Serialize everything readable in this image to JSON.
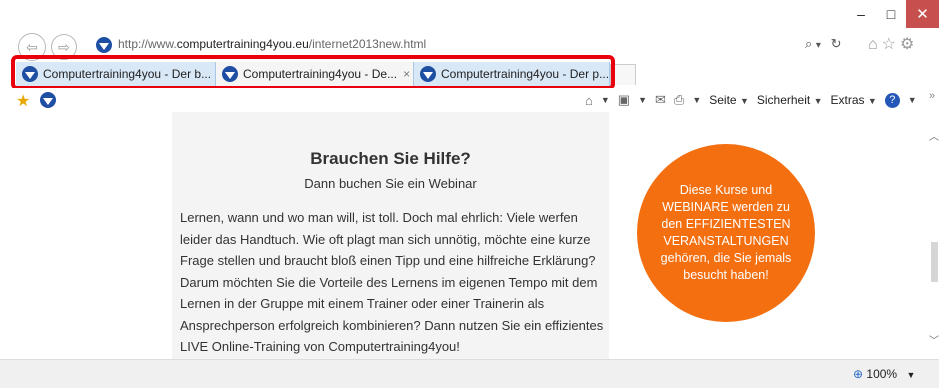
{
  "window": {
    "minimize": "–",
    "maximize": "□",
    "close": "✕"
  },
  "address": {
    "url_prefix": "http://www.",
    "url_domain": "computertraining4you.eu",
    "url_path": "/internet2013new.html",
    "search_icon": "⌕",
    "dropdown": "▾",
    "refresh": "↻"
  },
  "nav": {
    "back": "⇦",
    "forward": "⇨"
  },
  "right_icons": [
    "home-icon",
    "star-icon",
    "gear-icon"
  ],
  "tabs": [
    {
      "label": "Computertraining4you - Der b..."
    },
    {
      "label": "Computertraining4you - De...",
      "close": "×"
    },
    {
      "label": "Computertraining4you - Der p..."
    }
  ],
  "commandbar": {
    "items": [
      "Seite",
      "Sicherheit",
      "Extras"
    ],
    "dropdown": "▼",
    "more": "»"
  },
  "page": {
    "heading": "Brauchen Sie Hilfe?",
    "subheading": "Dann buchen Sie ein Webinar",
    "body": "Lernen, wann und wo man will, ist toll. Doch mal ehrlich: Viele werfen leider das Handtuch. Wie oft plagt man sich unnötig, möchte eine kurze Frage stellen und braucht bloß einen Tipp und eine hilfreiche Erklärung? Darum möchten Sie die Vorteile des Lernens im eigenen Tempo mit dem Lernen in der Gruppe mit einem Trainer oder einer Trainerin als Ansprechperson erfolgreich kombinieren? Dann nutzen Sie ein effizientes LIVE Online-Training von Computertraining4you!",
    "circle_text": "Diese Kurse und WEBINARE werden zu den EFFIZIENTESTEN VERANSTALTUNGEN gehören, die Sie jemals besucht haben!"
  },
  "status": {
    "zoom": "100%"
  },
  "colors": {
    "circle": "#f36f10",
    "highlight": "#e8000d",
    "tab_bg": "#d9e8f7"
  }
}
